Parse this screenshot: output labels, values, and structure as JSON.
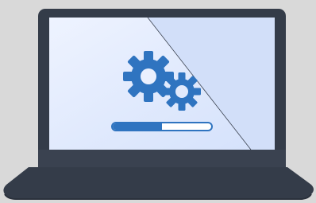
{
  "colors": {
    "background": "#d9d9d9",
    "laptop_body": "#343c49",
    "laptop_bezel": "#3a4250",
    "screen_light": "#eef3ff",
    "screen_dark": "#cfdcf8",
    "accent_blue": "#2f74c0"
  },
  "icons": {
    "large_gear": "gear-icon",
    "small_gear": "gear-icon"
  },
  "progress": {
    "fraction": 0.5
  }
}
